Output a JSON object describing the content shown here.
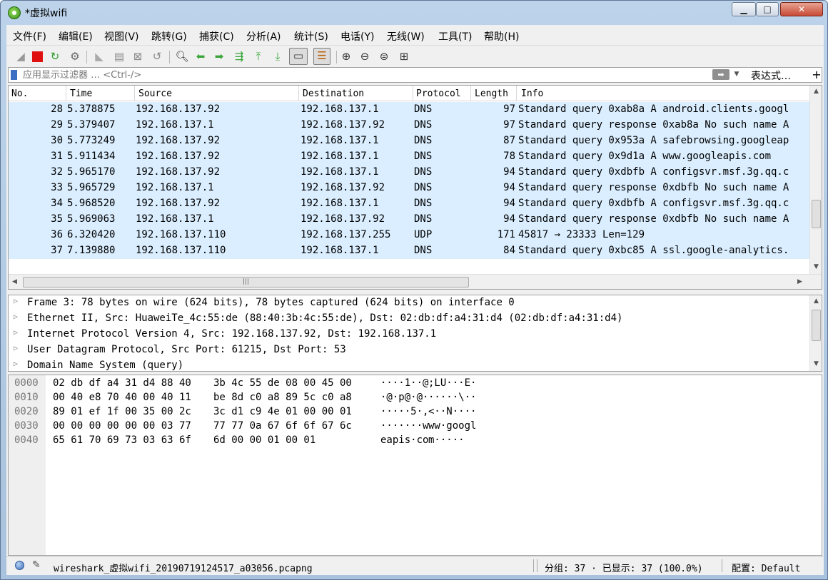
{
  "window": {
    "title": "*虚拟wifi"
  },
  "menu": [
    "文件(F)",
    "编辑(E)",
    "视图(V)",
    "跳转(G)",
    "捕获(C)",
    "分析(A)",
    "统计(S)",
    "电话(Y)",
    "无线(W)",
    "工具(T)",
    "帮助(H)"
  ],
  "toolbar": {
    "icons": [
      "shark-fin-start-icon",
      "stop-capture-icon",
      "restart-capture-icon",
      "capture-options-icon",
      "open-file-icon",
      "save-file-icon",
      "close-file-icon",
      "reload-file-icon",
      "find-packet-icon",
      "go-back-icon",
      "go-forward-icon",
      "go-to-packet-icon",
      "first-packet-icon",
      "last-packet-icon",
      "auto-scroll-icon",
      "colorize-icon",
      "zoom-in-icon",
      "zoom-out-icon",
      "zoom-normal-icon",
      "resize-columns-icon"
    ],
    "accent": "#1a73c4"
  },
  "filter": {
    "placeholder": "应用显示过滤器 … <Ctrl-/>",
    "expression_label": "表达式…",
    "add_label": "+"
  },
  "packet_list": {
    "columns": [
      "No.",
      "Time",
      "Source",
      "Destination",
      "Protocol",
      "Length",
      "Info"
    ],
    "row_color": "#daeeff",
    "rows": [
      {
        "no": "28",
        "time": "5.378875",
        "src": "192.168.137.92",
        "dst": "192.168.137.1",
        "proto": "DNS",
        "len": "97",
        "info": "Standard query 0xab8a A android.clients.googl"
      },
      {
        "no": "29",
        "time": "5.379407",
        "src": "192.168.137.1",
        "dst": "192.168.137.92",
        "proto": "DNS",
        "len": "97",
        "info": "Standard query response 0xab8a No such name A"
      },
      {
        "no": "30",
        "time": "5.773249",
        "src": "192.168.137.92",
        "dst": "192.168.137.1",
        "proto": "DNS",
        "len": "87",
        "info": "Standard query 0x953a A safebrowsing.googleap"
      },
      {
        "no": "31",
        "time": "5.911434",
        "src": "192.168.137.92",
        "dst": "192.168.137.1",
        "proto": "DNS",
        "len": "78",
        "info": "Standard query 0x9d1a A www.googleapis.com"
      },
      {
        "no": "32",
        "time": "5.965170",
        "src": "192.168.137.92",
        "dst": "192.168.137.1",
        "proto": "DNS",
        "len": "94",
        "info": "Standard query 0xdbfb A configsvr.msf.3g.qq.c"
      },
      {
        "no": "33",
        "time": "5.965729",
        "src": "192.168.137.1",
        "dst": "192.168.137.92",
        "proto": "DNS",
        "len": "94",
        "info": "Standard query response 0xdbfb No such name A"
      },
      {
        "no": "34",
        "time": "5.968520",
        "src": "192.168.137.92",
        "dst": "192.168.137.1",
        "proto": "DNS",
        "len": "94",
        "info": "Standard query 0xdbfb A configsvr.msf.3g.qq.c"
      },
      {
        "no": "35",
        "time": "5.969063",
        "src": "192.168.137.1",
        "dst": "192.168.137.92",
        "proto": "DNS",
        "len": "94",
        "info": "Standard query response 0xdbfb No such name A"
      },
      {
        "no": "36",
        "time": "6.320420",
        "src": "192.168.137.110",
        "dst": "192.168.137.255",
        "proto": "UDP",
        "len": "171",
        "info": "45817 → 23333 Len=129"
      },
      {
        "no": "37",
        "time": "7.139880",
        "src": "192.168.137.110",
        "dst": "192.168.137.1",
        "proto": "DNS",
        "len": "84",
        "info": "Standard query 0xbc85 A ssl.google-analytics."
      }
    ],
    "hscroll_grip": "|||"
  },
  "details": [
    "Frame 3: 78 bytes on wire (624 bits), 78 bytes captured (624 bits) on interface 0",
    "Ethernet II, Src: HuaweiTe_4c:55:de (88:40:3b:4c:55:de), Dst: 02:db:df:a4:31:d4 (02:db:df:a4:31:d4)",
    "Internet Protocol Version 4, Src: 192.168.137.92, Dst: 192.168.137.1",
    "User Datagram Protocol, Src Port: 61215, Dst Port: 53",
    "Domain Name System (query)"
  ],
  "hex": [
    {
      "offset": "0000",
      "b1": "02 db df a4 31 d4 88 40",
      "b2": "3b 4c 55 de 08 00 45 00",
      "a1": "····1··@",
      "a2": ";LU···E·"
    },
    {
      "offset": "0010",
      "b1": "00 40 e8 70 40 00 40 11",
      "b2": "be 8d c0 a8 89 5c c0 a8",
      "a1": "·@·p@·@·",
      "a2": "·····\\··"
    },
    {
      "offset": "0020",
      "b1": "89 01 ef 1f 00 35 00 2c",
      "b2": "3c d1 c9 4e 01 00 00 01",
      "a1": "·····5·,",
      "a2": "<··N····"
    },
    {
      "offset": "0030",
      "b1": "00 00 00 00 00 00 03 77",
      "b2": "77 77 0a 67 6f 6f 67 6c",
      "a1": "·······w",
      "a2": "ww·googl"
    },
    {
      "offset": "0040",
      "b1": "65 61 70 69 73 03 63 6f",
      "b2": "6d 00 00 01 00 01",
      "a1": "eapis·co",
      "a2": "m·····"
    }
  ],
  "status": {
    "file": "wireshark_虚拟wifi_20190719124517_a03056.pcapng",
    "packets": "分组: 37 · 已显示: 37 (100.0%)",
    "profile": "配置: Default"
  }
}
